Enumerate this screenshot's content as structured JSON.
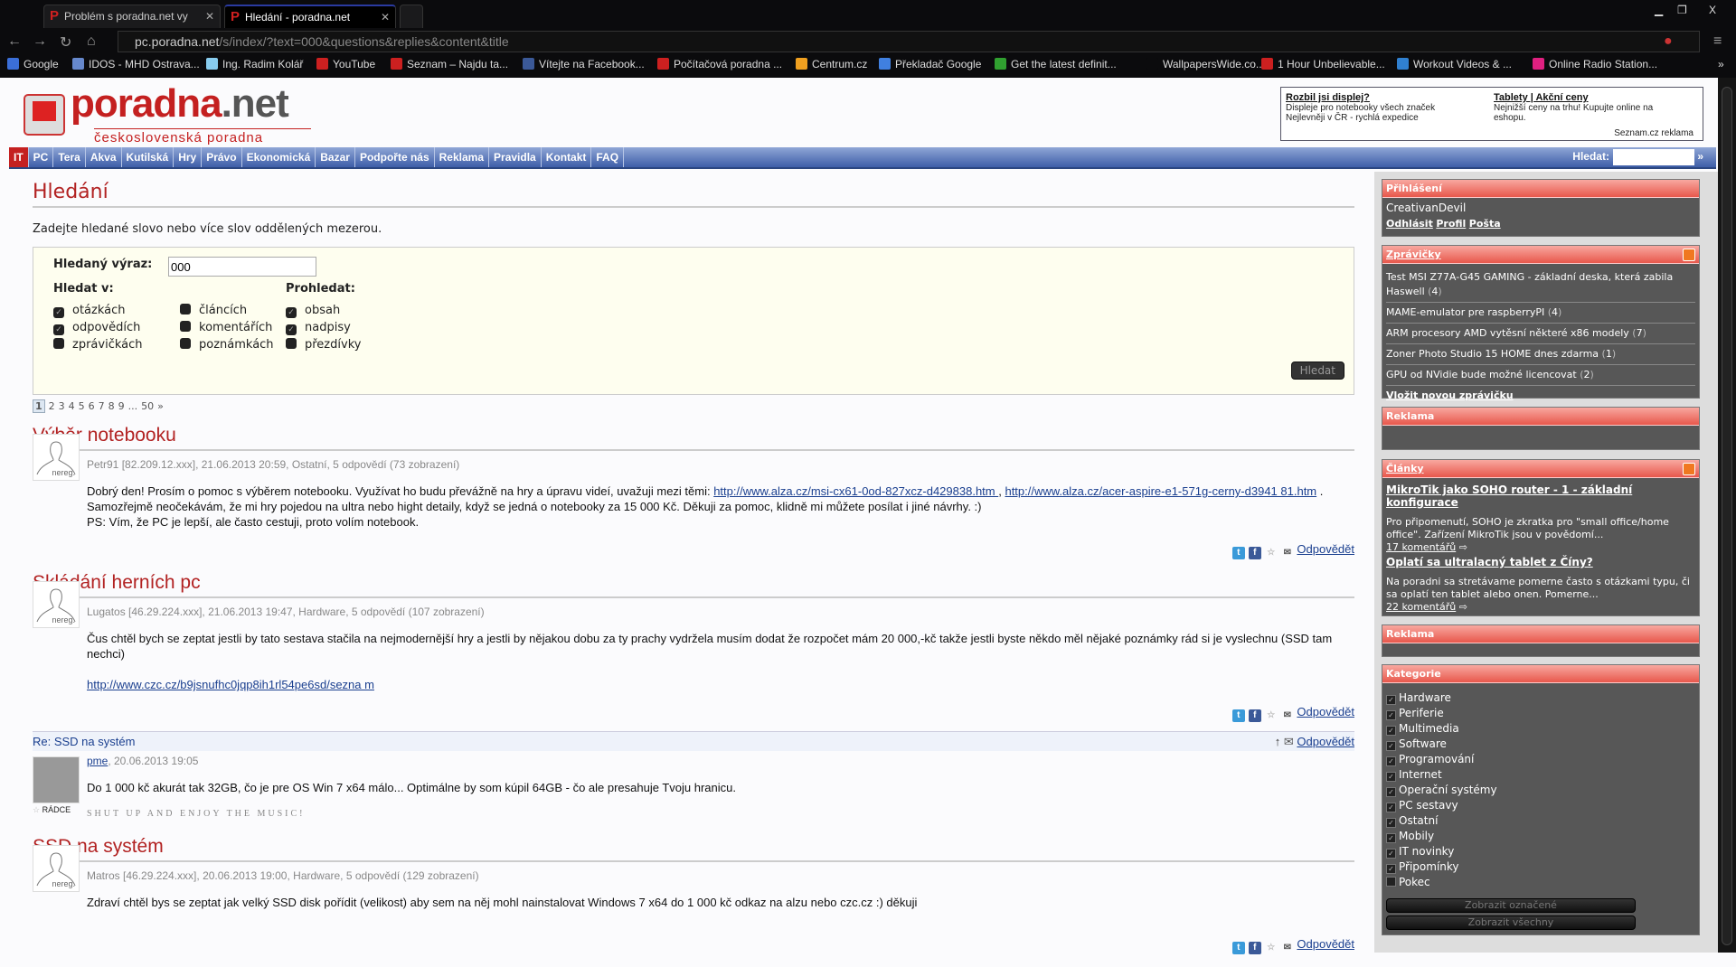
{
  "browser": {
    "tabs": [
      {
        "title": "Problém s poradna.net vy",
        "active": false
      },
      {
        "title": "Hledání - poradna.net",
        "active": true
      }
    ],
    "url_host": "pc.poradna.net",
    "url_path": "/s/index/?text=000&questions&replies&content&title",
    "bookmarks": [
      "Google",
      "IDOS - MHD Ostrava...",
      "Ing. Radim Kolář",
      "YouTube",
      "Seznam – Najdu ta...",
      "Vítejte na Facebook...",
      "Počítačová poradna ...",
      "Centrum.cz",
      "Překladač Google",
      "Get the latest definit...",
      "WallpapersWide.co...",
      "1 Hour Unbelievable...",
      "Workout Videos & ...",
      "Online Radio Station..."
    ],
    "bookmark_colors": [
      "#3b6fd8",
      "#6688cc",
      "#88ccee",
      "#cc2020",
      "#cc2020",
      "#3b5998",
      "#cc2020",
      "#f0a020",
      "#4080e0",
      "#30a030",
      "#0b0b0d",
      "#cc2020",
      "#3080d0",
      "#e02080"
    ]
  },
  "site": {
    "logo_main": "poradna",
    "logo_tld": ".net",
    "logo_sub": "československá poradna",
    "ad": {
      "left_title": "Rozbil jsi displej?",
      "left_l1": "Displeje pro notebooky všech značek",
      "left_l2": "Nejlevněji v ČR - rychlá expedice",
      "right_title": "Tablety | Akční ceny",
      "right_text": "Nejnižší ceny na trhu! Kupujte online na eshopu.",
      "brand": "Seznam.cz reklama"
    },
    "nav": [
      "IT",
      "PC",
      "Tera",
      "Akva",
      "Kutilská",
      "Hry",
      "Právo",
      "Ekonomická",
      "Bazar",
      "Podpořte nás",
      "Reklama",
      "Pravidla",
      "Kontakt",
      "FAQ"
    ],
    "search_label": "Hledat:",
    "search_go": "»"
  },
  "search": {
    "title": "Hledání",
    "intro": "Zadejte hledané slovo nebo více slov oddělených mezerou.",
    "query_label": "Hledaný výraz:",
    "query_value": "000",
    "in_label": "Hledat v:",
    "scope_label": "Prohledat:",
    "in_options": [
      {
        "label": "otázkách",
        "checked": true
      },
      {
        "label": "odpovědích",
        "checked": true
      },
      {
        "label": "zprávičkách",
        "checked": false
      },
      {
        "label": "článcích",
        "checked": false
      },
      {
        "label": "komentářích",
        "checked": false
      },
      {
        "label": "poznámkách",
        "checked": false
      }
    ],
    "scope_options": [
      {
        "label": "obsah",
        "checked": true
      },
      {
        "label": "nadpisy",
        "checked": true
      },
      {
        "label": "přezdívky",
        "checked": false
      }
    ],
    "submit": "Hledat"
  },
  "pager": {
    "pages": [
      "1",
      "2",
      "3",
      "4",
      "5",
      "6",
      "7",
      "8",
      "9",
      "...",
      "50",
      "»"
    ],
    "current": "1"
  },
  "posts": [
    {
      "title": "Výběr notebooku",
      "meta": "Petr91 [82.209.12.xxx], 21.06.2013 20:59, Ostatní, 5 odpovědí (73 zobrazení)",
      "avatar": "nereg.",
      "t1": "Dobrý den! Prosím o pomoc s výběrem notebooku. Využívat ho budu převážně na hry a úpravu videí, uvažuji mezi těmi: ",
      "l1": "http://www.alza.cz/msi-cx61-0od-827xcz-d429838.htm ",
      "t2": ", ",
      "l2": "http://www.alza.cz/acer-aspire-e1-571g-cerny-d3941 81.htm",
      "t3": " . Samozřejmě neočekávám, že mi hry pojedou na ultra nebo hight detaily, když se jedná o notebooky za 15 000 Kč. Děkuji za pomoc, klidně mi můžete posílat i jiné návrhy. :)",
      "t4": "PS: Vím, že PC je lepší, ale často cestuji, proto volím notebook.",
      "reply": "Odpovědět"
    },
    {
      "title": "Skládání herních pc",
      "meta": "Lugatos [46.29.224.xxx], 21.06.2013 19:47, Hardware, 5 odpovědí (107 zobrazení)",
      "avatar": "nereg.",
      "t1": "Čus chtěl bych se zeptat jestli by tato sestava stačila na nejmodernější hry a jestli by nějakou dobu za ty prachy vydržela musím dodat že rozpočet mám 20 000,-kč takže jestli byste někdo měl nějaké poznámky rád si je vyslechnu (SSD tam nechci)",
      "l1": "http://www.czc.cz/b9jsnufhc0jqp8ih1rl54pe6sd/sezna m",
      "reply": "Odpovědět"
    },
    {
      "reply_title": "Re: SSD na systém",
      "user": "pme",
      "meta": ", 20.06.2013 19:05",
      "badge": "RÁDCE",
      "text": "Do 1 000 kč akurát tak 32GB, čo je pre OS Win 7 x64 málo... Optimálne by som kúpil 64GB - čo ale presahuje Tvoju hranicu.",
      "signature": "SHUT UP AND ENJOY THE MUSIC!",
      "reply": "Odpovědět"
    },
    {
      "title": "SSD na systém",
      "meta": "Matros [46.29.224.xxx], 20.06.2013 19:00, Hardware, 5 odpovědí (129 zobrazení)",
      "avatar": "nereg.",
      "t1": "Zdraví chtěl bys se zeptat jak velký SSD disk pořídit (velikost) aby sem na něj mohl nainstalovat Windows 7 x64 do 1 000 kč odkaz na alzu nebo czc.cz :) děkuji",
      "reply": "Odpovědět"
    }
  ],
  "sidebar": {
    "login": {
      "title": "Přihlášení",
      "user": "CreativanDevil",
      "links": [
        "Odhlásit",
        "Profil",
        "Pošta"
      ]
    },
    "news": {
      "title": "Zprávičky",
      "items": [
        {
          "t": "Test MSI Z77A-G45 GAMING - základní deska, která zabila Haswell",
          "n": "4"
        },
        {
          "t": "MAME-emulator pre raspberryPI",
          "n": "4"
        },
        {
          "t": "ARM procesory AMD vytěsní některé x86 modely",
          "n": "7"
        },
        {
          "t": "Zoner Photo Studio 15 HOME dnes zdarma",
          "n": "1"
        },
        {
          "t": "GPU od NVidie bude možné licencovat",
          "n": "2"
        }
      ],
      "add": "Vložit novou zprávičku"
    },
    "ad1": "Reklama",
    "ad2": "Reklama",
    "articles": {
      "title": "Články",
      "items": [
        {
          "t": "MikroTik jako SOHO router - 1 - základní konfigurace",
          "d": "Pro připomenutí, SOHO je zkratka pro \"small office/home office\". Zařízení MikroTik jsou v povědomí...",
          "c": "17 komentářů"
        },
        {
          "t": "Oplatí sa ultralacný tablet z Číny?",
          "d": "Na poradni sa stretávame pomerne často s otázkami typu, či sa oplatí ten tablet alebo onen. Pomerne...",
          "c": "22 komentářů"
        }
      ]
    },
    "categories": {
      "title": "Kategorie",
      "items": [
        {
          "l": "Hardware",
          "c": true
        },
        {
          "l": "Periferie",
          "c": true
        },
        {
          "l": "Multimedia",
          "c": true
        },
        {
          "l": "Software",
          "c": true
        },
        {
          "l": "Programování",
          "c": true
        },
        {
          "l": "Internet",
          "c": true
        },
        {
          "l": "Operační systémy",
          "c": true
        },
        {
          "l": "PC sestavy",
          "c": true
        },
        {
          "l": "Ostatní",
          "c": true
        },
        {
          "l": "Mobily",
          "c": true
        },
        {
          "l": "IT novinky",
          "c": true
        },
        {
          "l": "Připomínky",
          "c": true
        },
        {
          "l": "Pokec",
          "c": false
        }
      ],
      "btn_marked": "Zobrazit označené",
      "btn_all": "Zobrazit všechny"
    }
  }
}
